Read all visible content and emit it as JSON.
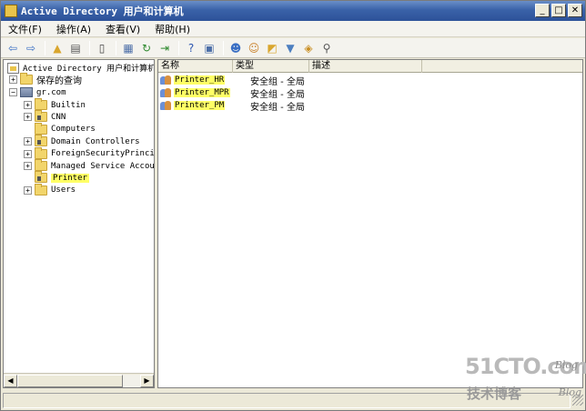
{
  "window": {
    "title": "Active Directory 用户和计算机",
    "controls": [
      "_",
      "□",
      "✕"
    ]
  },
  "menubar": {
    "items": [
      "文件(F)",
      "操作(A)",
      "查看(V)",
      "帮助(H)"
    ]
  },
  "toolbar": {
    "buttons": [
      {
        "icon": "back-arrow-icon",
        "glyph": "⇦",
        "color": "#3a6fc4"
      },
      {
        "icon": "forward-arrow-icon",
        "glyph": "⇨",
        "color": "#3a6fc4"
      },
      {
        "icon": "up-folder-icon",
        "glyph": "▲",
        "color": "#d9a62e"
      },
      {
        "icon": "show-tree-icon",
        "glyph": "▤",
        "color": "#555555"
      },
      {
        "icon": "copy-icon",
        "glyph": "▯",
        "color": "#444444"
      },
      {
        "icon": "properties-icon",
        "glyph": "▦",
        "color": "#4d6fa8"
      },
      {
        "icon": "refresh-icon",
        "glyph": "↻",
        "color": "#2f8a2f"
      },
      {
        "icon": "export-list-icon",
        "glyph": "⇥",
        "color": "#2f8a2f"
      },
      {
        "icon": "help-icon",
        "glyph": "?",
        "color": "#2d56b0"
      },
      {
        "icon": "action-pane-icon",
        "glyph": "▣",
        "color": "#4d6fa8"
      },
      {
        "icon": "new-user-icon",
        "glyph": "☻",
        "color": "#3a6fc4"
      },
      {
        "icon": "new-group-icon",
        "glyph": "☺",
        "color": "#c9822c"
      },
      {
        "icon": "new-ou-icon",
        "glyph": "◩",
        "color": "#d9a62e"
      },
      {
        "icon": "filter-icon",
        "glyph": "▼",
        "color": "#4d7fc0"
      },
      {
        "icon": "add-to-group-icon",
        "glyph": "◈",
        "color": "#c98f24"
      },
      {
        "icon": "find-icon",
        "glyph": "⚲",
        "color": "#555555"
      }
    ]
  },
  "tree": {
    "root": "Active Directory 用户和计算机",
    "saved_queries": "保存的查询",
    "domain": "gr.com",
    "items": [
      {
        "label": "Builtin",
        "type": "folder",
        "expander": "+"
      },
      {
        "label": "CNN",
        "type": "ou",
        "expander": "+"
      },
      {
        "label": "Computers",
        "type": "folder",
        "expander": ""
      },
      {
        "label": "Domain Controllers",
        "type": "ou",
        "expander": "+"
      },
      {
        "label": "ForeignSecurityPrincip",
        "type": "folder",
        "expander": "+"
      },
      {
        "label": "Managed Service Accour",
        "type": "folder",
        "expander": "+"
      },
      {
        "label": "Printer",
        "type": "ou",
        "expander": "",
        "selected": true
      },
      {
        "label": "Users",
        "type": "folder",
        "expander": "+"
      }
    ]
  },
  "list": {
    "columns": [
      "名称",
      "类型",
      "描述"
    ],
    "rows": [
      {
        "name": "Printer_HR",
        "type": "安全组 - 全局",
        "description": ""
      },
      {
        "name": "Printer_MPR",
        "type": "安全组 - 全局",
        "description": ""
      },
      {
        "name": "Printer_PM",
        "type": "安全组 - 全局",
        "description": ""
      }
    ]
  },
  "watermark": {
    "main": "51CTO.com",
    "sub": "技术博客",
    "blog": "Blog"
  },
  "colors": {
    "highlight": "#ffff66",
    "titlebar": "#2d5299"
  }
}
